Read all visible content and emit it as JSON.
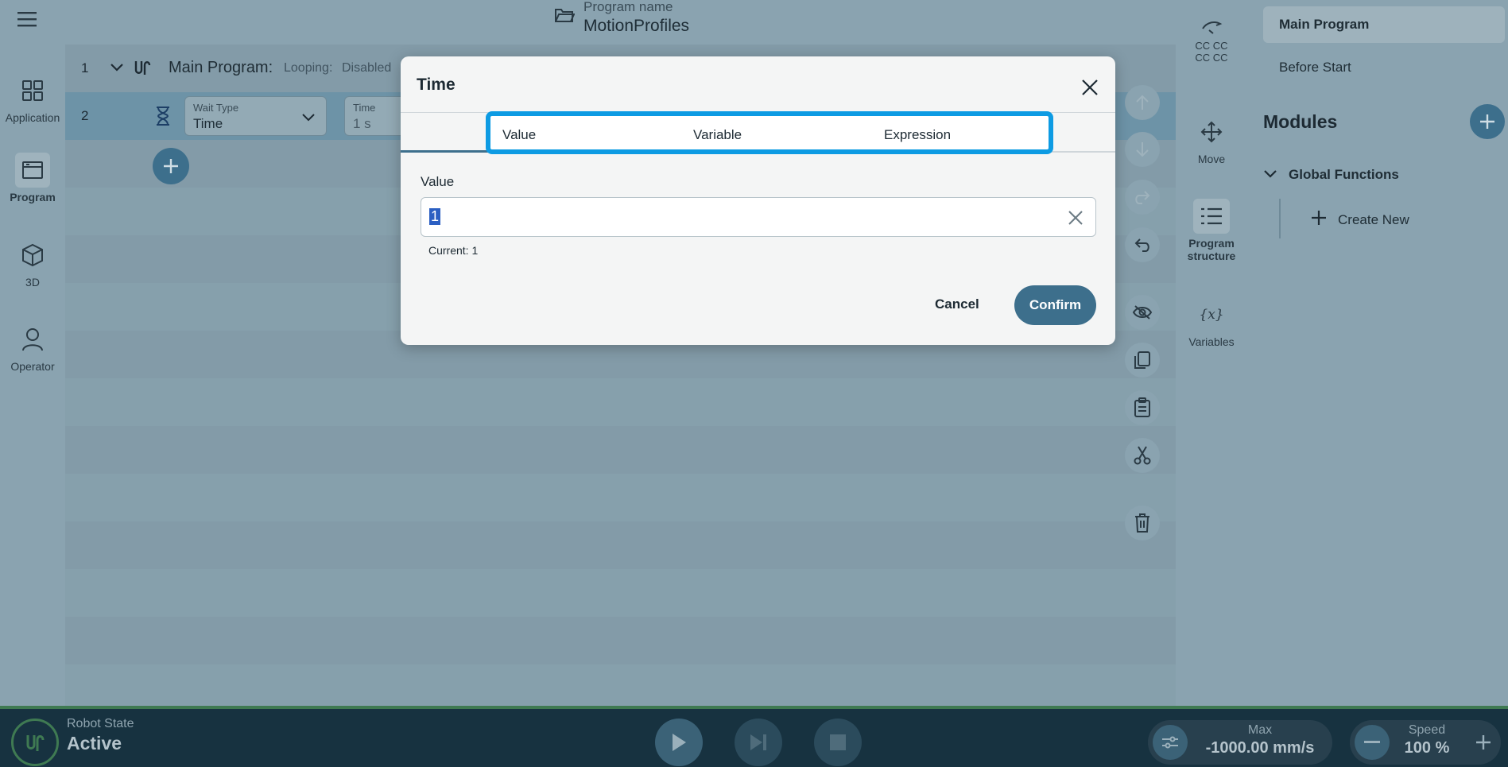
{
  "leftnav": {
    "items": [
      {
        "label": "Application",
        "icon": "grid-icon"
      },
      {
        "label": "Program",
        "icon": "program-window-icon"
      },
      {
        "label": "3D",
        "icon": "cube-icon"
      },
      {
        "label": "Operator",
        "icon": "person-icon"
      }
    ]
  },
  "header": {
    "program_label": "Program name",
    "program_name": "MotionProfiles"
  },
  "tree": {
    "row1": {
      "number": "1",
      "title": "Main Program:",
      "looping_label": "Looping:",
      "looping_value": "Disabled"
    },
    "row2": {
      "number": "2",
      "wait_type_label": "Wait Type",
      "wait_type_value": "Time",
      "time_label": "Time",
      "time_value": "1 s"
    }
  },
  "rightstrip": {
    "tcp_label": "CC CC\nCC CC",
    "items": [
      {
        "label": "Move"
      },
      {
        "label": "Program structure"
      },
      {
        "label": "Variables",
        "icon_text": "{x}"
      }
    ]
  },
  "rightpanel": {
    "main_program": "Main Program",
    "before_start": "Before Start",
    "modules": "Modules",
    "global_functions": "Global Functions",
    "create_new": "Create New"
  },
  "footer": {
    "robot_state_label": "Robot State",
    "robot_state_value": "Active",
    "max_label": "Max",
    "max_value": "-1000.00 mm/s",
    "speed_label": "Speed",
    "speed_value": "100 %"
  },
  "dialog": {
    "title": "Time",
    "tabs": [
      "Value",
      "Variable",
      "Expression"
    ],
    "value_label": "Value",
    "input_value": "1",
    "current_text": "Current: 1",
    "cancel_label": "Cancel",
    "confirm_label": "Confirm"
  },
  "colors": {
    "accent": "#3d6f8c",
    "highlight": "#0d9be3",
    "footer_bg": "#173240",
    "active_green": "#3f7a52"
  }
}
